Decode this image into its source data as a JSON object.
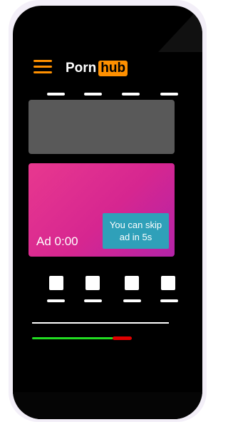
{
  "header": {
    "menu_icon": "hamburger-menu-icon",
    "logo_part1": "Porn",
    "logo_part2": "hub"
  },
  "ad": {
    "timer_label": "Ad 0:00",
    "skip_label": "You can skip ad in 5s"
  },
  "progress": {
    "played_fraction": 0.82
  },
  "colors": {
    "brand_orange": "#ff9000",
    "placeholder_gray": "#595959",
    "ad_gradient_start": "#e8388f",
    "ad_gradient_end": "#b323a8",
    "skip_teal": "#2fa0b9",
    "progress_green": "#22dd22",
    "progress_red": "#e00000"
  }
}
